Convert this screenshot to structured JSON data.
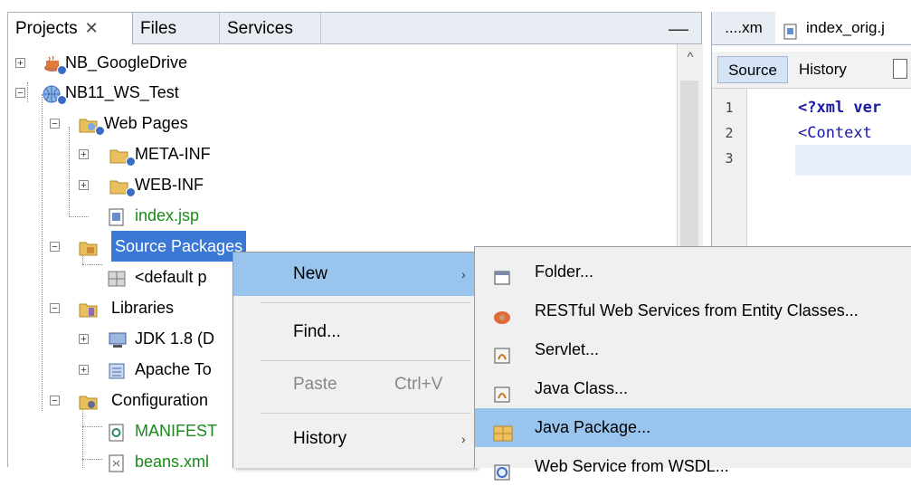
{
  "projects_panel": {
    "tabs": [
      {
        "label": "Projects",
        "close": "✕"
      },
      {
        "label": "Files"
      },
      {
        "label": "Services"
      }
    ],
    "minimize_glyph": "—",
    "scroll_up_glyph": "^",
    "tree": [
      {
        "label": "NB_GoogleDrive"
      },
      {
        "label": "NB11_WS_Test"
      },
      {
        "label": "Web Pages"
      },
      {
        "label": "META-INF"
      },
      {
        "label": "WEB-INF"
      },
      {
        "label": "index.jsp"
      },
      {
        "label": "Source Packages"
      },
      {
        "label": "<default p"
      },
      {
        "label": "Libraries"
      },
      {
        "label": "JDK 1.8 (D"
      },
      {
        "label": "Apache To"
      },
      {
        "label": "Configuration"
      },
      {
        "label": "MANIFEST"
      },
      {
        "label": "beans.xml"
      }
    ]
  },
  "editor": {
    "tabs": [
      "....xm",
      "index_orig.j"
    ],
    "toolbar": {
      "source": "Source",
      "history": "History"
    },
    "line_numbers": [
      "1",
      "2",
      "3"
    ],
    "code": [
      "<?xml ver",
      "<Context"
    ]
  },
  "context_menu": {
    "items": [
      {
        "label": "New",
        "arrow": "›"
      },
      {
        "label": "Find..."
      },
      {
        "label": "Paste",
        "shortcut": "Ctrl+V"
      },
      {
        "label": "History",
        "arrow": "›"
      }
    ]
  },
  "submenu": {
    "items": [
      {
        "label": "Folder...",
        "icon": "folder-icon"
      },
      {
        "label": "RESTful Web Services from Entity Classes...",
        "icon": "restful-icon"
      },
      {
        "label": "Servlet...",
        "icon": "servlet-icon"
      },
      {
        "label": "Java Class...",
        "icon": "java-class-icon"
      },
      {
        "label": "Java Package...",
        "icon": "java-package-icon"
      },
      {
        "label": "Web Service from WSDL...",
        "icon": "wsdl-icon"
      }
    ]
  },
  "colors": {
    "selection": "#3b78d6",
    "menu_hover": "#99c4ee",
    "green_file": "#1a8a1a",
    "code_blue": "#1a1aa6"
  }
}
